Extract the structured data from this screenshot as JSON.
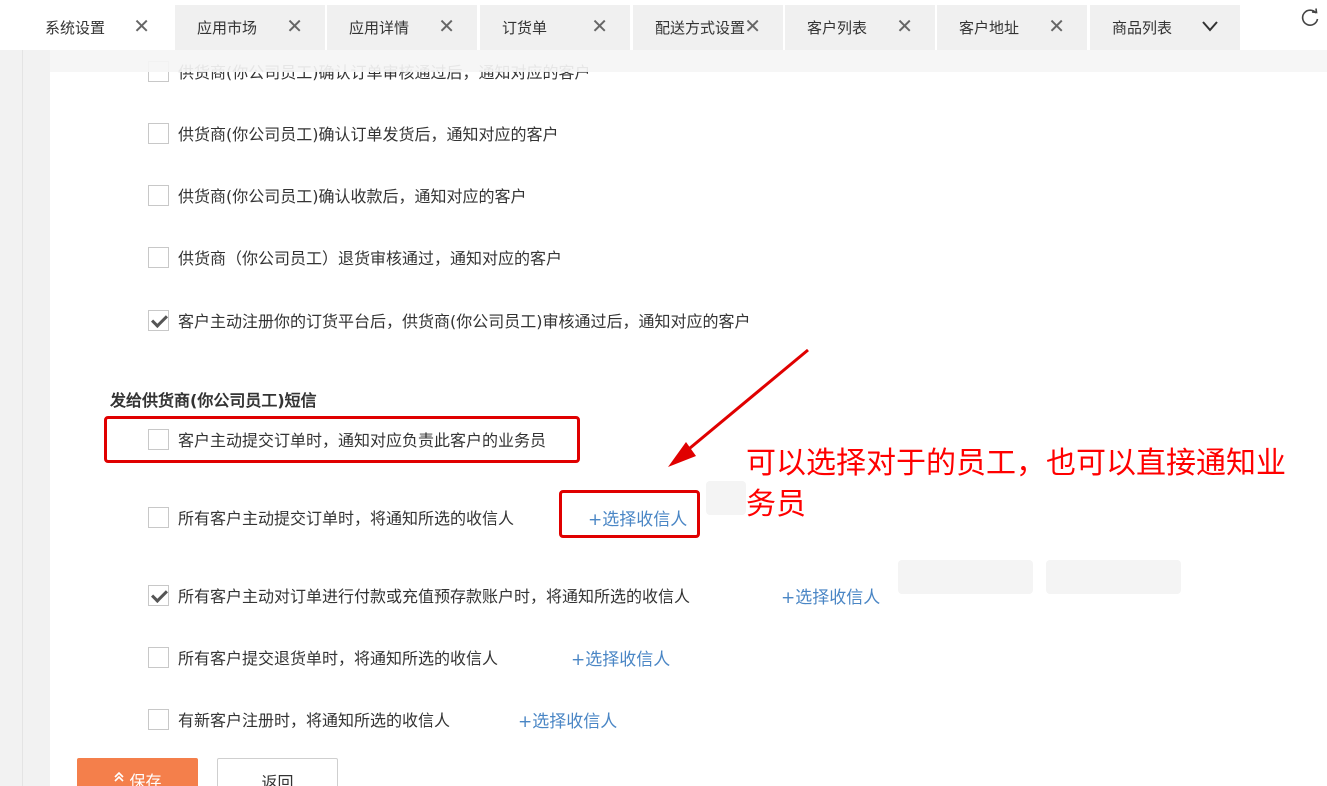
{
  "tabs": [
    {
      "label": "系统设置",
      "active": true
    },
    {
      "label": "应用市场"
    },
    {
      "label": "应用详情"
    },
    {
      "label": "订货单"
    },
    {
      "label": "配送方式设置"
    },
    {
      "label": "客户列表"
    },
    {
      "label": "客户地址"
    },
    {
      "label": "商品列表"
    }
  ],
  "icons": {
    "tab_close": "close-icon",
    "tab_more": "chevron-down-icon",
    "refresh": "refresh-icon",
    "save": "double-chevron-up-icon"
  },
  "customer_sms": {
    "items": [
      {
        "label": "供货商(你公司员工)确认订单审核通过后，通知对应的客户",
        "checked": false
      },
      {
        "label": "供货商(你公司员工)确认订单发货后，通知对应的客户",
        "checked": false
      },
      {
        "label": "供货商(你公司员工)确认收款后，通知对应的客户",
        "checked": false
      },
      {
        "label": "供货商（你公司员工）退货审核通过，通知对应的客户",
        "checked": false
      },
      {
        "label": "客户主动注册你的订货平台后，供货商(你公司员工)审核通过后，通知对应的客户",
        "checked": true
      }
    ]
  },
  "supplier_sms": {
    "title": "发给供货商(你公司员工)短信",
    "items": [
      {
        "label": "客户主动提交订单时，通知对应负责此客户的业务员",
        "checked": false
      },
      {
        "label": "所有客户主动提交订单时，将通知所选的收信人",
        "checked": false,
        "picker": "+选择收信人"
      },
      {
        "label": "所有客户主动对订单进行付款或充值预存款账户时，将通知所选的收信人",
        "checked": true,
        "picker": "+选择收信人"
      },
      {
        "label": "所有客户提交退货单时，将通知所选的收信人",
        "checked": false,
        "picker": "+选择收信人"
      },
      {
        "label": "有新客户注册时，将通知所选的收信人",
        "checked": false,
        "picker": "+选择收信人"
      }
    ]
  },
  "annotation": {
    "text": "可以选择对于的员工，也可以直接通知业务员",
    "color": "#ff0000"
  },
  "buttons": {
    "save": "保存",
    "back": "返回"
  },
  "colors": {
    "accent": "#f47f4b",
    "link": "#4a86c5",
    "highlight": "#e00000"
  }
}
